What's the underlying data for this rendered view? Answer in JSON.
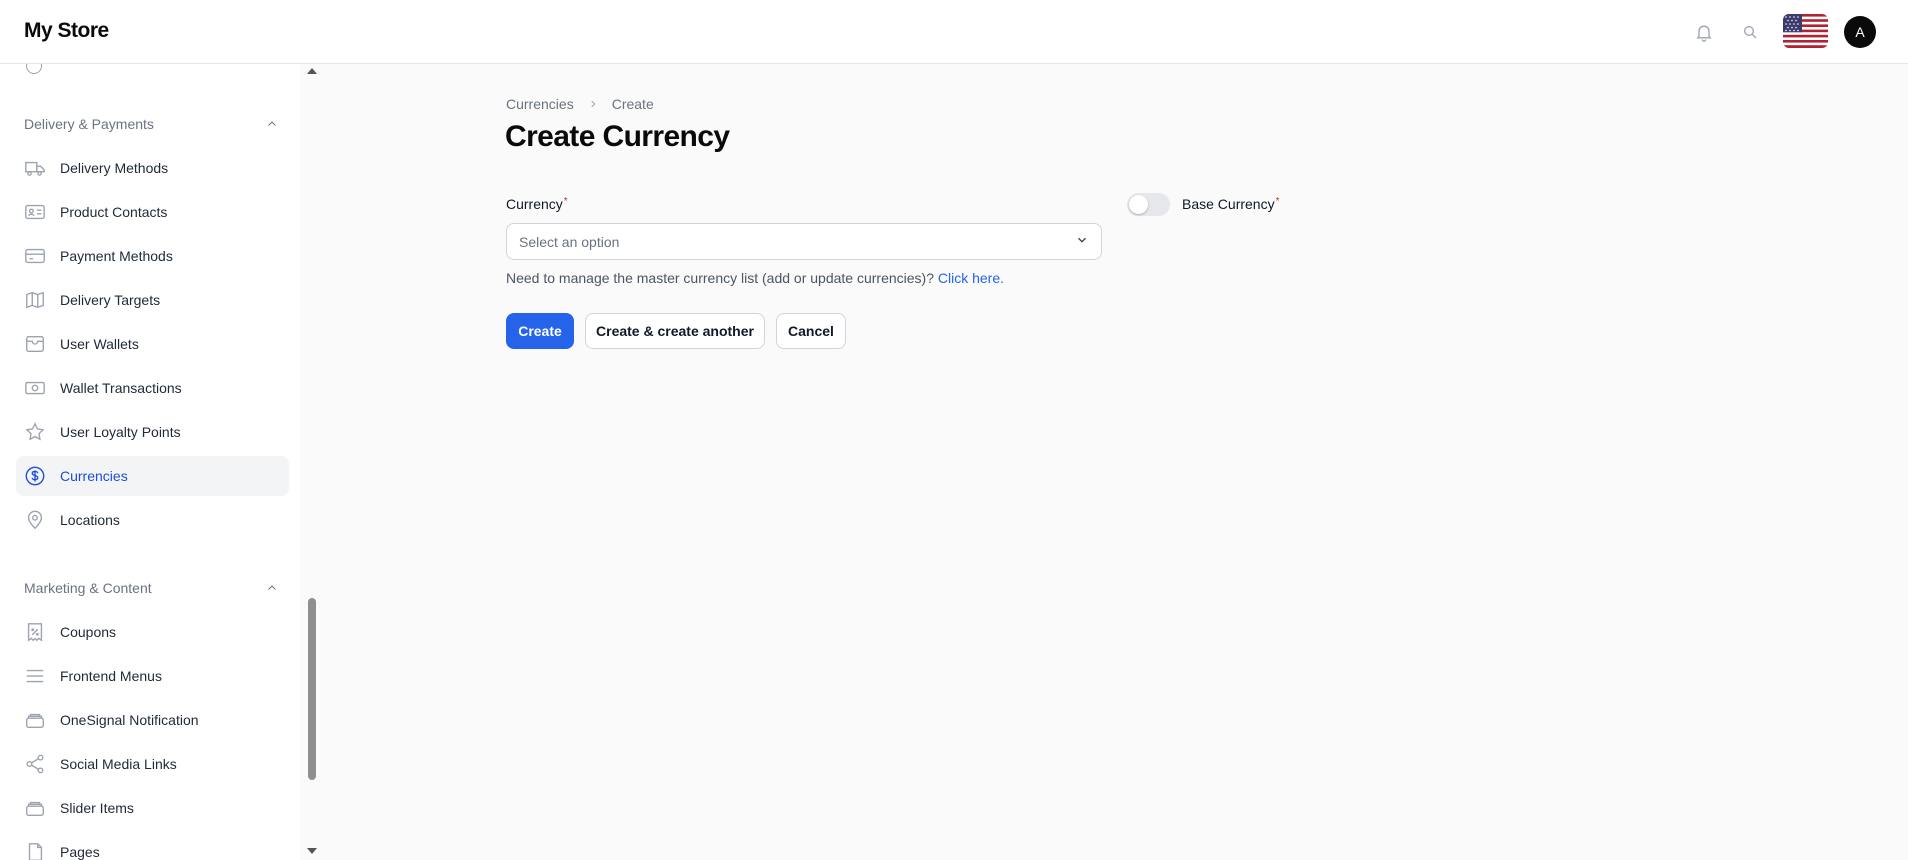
{
  "app": {
    "brand": "My Store"
  },
  "header": {
    "icons": [
      "bell-icon",
      "search-icon",
      "us-flag-icon"
    ],
    "avatar_initial": "A"
  },
  "sidebar": {
    "groups": [
      {
        "label": "Delivery & Payments",
        "items": [
          {
            "label": "Delivery Methods",
            "icon": "truck-icon"
          },
          {
            "label": "Product Contacts",
            "icon": "contact-card-icon"
          },
          {
            "label": "Payment Methods",
            "icon": "credit-card-icon"
          },
          {
            "label": "Delivery Targets",
            "icon": "map-icon"
          },
          {
            "label": "User Wallets",
            "icon": "wallet-icon"
          },
          {
            "label": "Wallet Transactions",
            "icon": "cash-icon"
          },
          {
            "label": "User Loyalty Points",
            "icon": "star-icon"
          },
          {
            "label": "Currencies",
            "icon": "currency-dollar-icon",
            "active": true
          },
          {
            "label": "Locations",
            "icon": "map-pin-icon"
          }
        ]
      },
      {
        "label": "Marketing & Content",
        "items": [
          {
            "label": "Coupons",
            "icon": "receipt-percent-icon"
          },
          {
            "label": "Frontend Menus",
            "icon": "menu-lines-icon"
          },
          {
            "label": "OneSignal Notification",
            "icon": "stack-icon"
          },
          {
            "label": "Social Media Links",
            "icon": "share-icon"
          },
          {
            "label": "Slider Items",
            "icon": "stack-icon"
          },
          {
            "label": "Pages",
            "icon": "document-icon"
          }
        ]
      }
    ]
  },
  "breadcrumb": {
    "parent": "Currencies",
    "current": "Create"
  },
  "page": {
    "title": "Create Currency"
  },
  "form": {
    "currency_label": "Currency",
    "required_mark": "*",
    "currency_placeholder": "Select an option",
    "help_text": "Need to manage the master currency list (add or update currencies)?",
    "help_link": "Click here.",
    "base_currency_label": "Base Currency",
    "base_currency_on": false
  },
  "buttons": {
    "create": "Create",
    "create_another": "Create & create another",
    "cancel": "Cancel"
  },
  "colors": {
    "primary": "#2563eb",
    "active_nav_text": "#1d4ed8",
    "required": "#dc2626"
  }
}
